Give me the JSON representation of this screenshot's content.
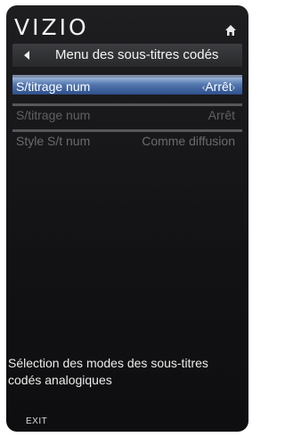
{
  "header": {
    "logo_text": "VIZIO",
    "home_icon": "home-icon"
  },
  "menu": {
    "title": "Menu des sous-titres codés",
    "back_icon": "back-arrow-icon",
    "items": [
      {
        "label": "S/titrage num",
        "value": "Arrêt",
        "selected": true
      },
      {
        "label": "S/titrage num",
        "value": "Arrêt",
        "selected": false
      },
      {
        "label": "Style S/t num",
        "value": "Comme diffusion",
        "selected": false
      }
    ]
  },
  "description": "Sélection des modes des sous-titres codés analogiques",
  "footer": {
    "exit_label": "EXIT"
  },
  "colors": {
    "panel_bg": "#121214",
    "selected_row": "#5377b0",
    "title_bar": "#333437",
    "dim_text": "#5f6063"
  }
}
